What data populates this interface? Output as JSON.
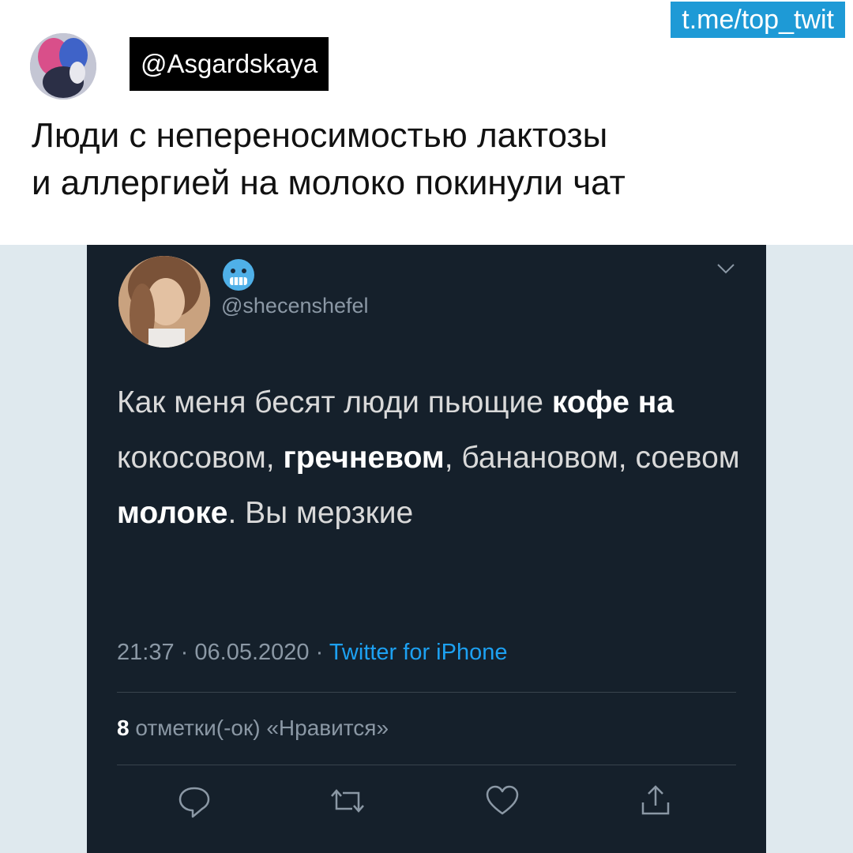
{
  "header": {
    "channel_tag": "t.me/top_twit",
    "author_handle": "@Asgardskaya",
    "caption_line1": "Люди с непереносимостью лактозы",
    "caption_line2": "и аллергией на молоко покинули чат"
  },
  "tweet": {
    "handle": "@shecenshefel",
    "body": [
      {
        "text": "Как меня бесят люди пьющие ",
        "bold": false
      },
      {
        "text": "кофе на",
        "bold": true
      },
      {
        "text": " кокосовом, ",
        "bold": false
      },
      {
        "text": "гречневом",
        "bold": true
      },
      {
        "text": ", банановом, соевом ",
        "bold": false
      },
      {
        "text": "молоке",
        "bold": true
      },
      {
        "text": ". Вы мерзкие",
        "bold": false
      }
    ],
    "time": "21:37",
    "date": "06.05.2020",
    "separator": "·",
    "source": "Twitter for iPhone",
    "likes_count": "8",
    "likes_label": "отметки(-ок) «Нравится»",
    "actions": [
      "reply-icon",
      "retweet-icon",
      "like-icon",
      "share-icon"
    ]
  },
  "colors": {
    "tweet_background": "#15202b",
    "accent": "#1da1f2",
    "channel_tag": "#1e9ad6",
    "page_background": "#dfe9ee"
  }
}
